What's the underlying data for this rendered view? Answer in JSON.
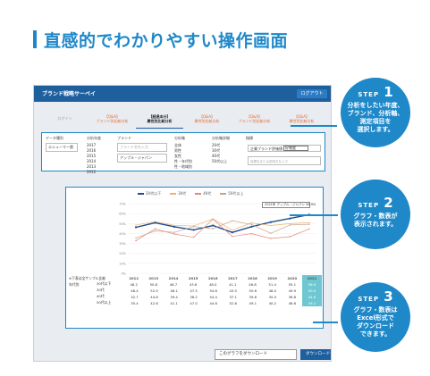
{
  "headline": "直感的でわかりやすい操作画面",
  "app": {
    "title": "ブランド戦略サーベイ",
    "logout": "ログアウト",
    "tabs": [
      {
        "top": "ログイン",
        "sub": "",
        "state": "muted"
      },
      {
        "top": "【Q&A】",
        "sub": "ブランド別比較分析",
        "state": ""
      },
      {
        "top": "【経過本分】",
        "sub": "属性別比較分析",
        "state": "active"
      },
      {
        "top": "【Q&A】",
        "sub": "属性別比較分析",
        "state": ""
      },
      {
        "top": "【Q&A】",
        "sub": "ブランド別比較分析",
        "state": ""
      },
      {
        "top": "【Q&A】",
        "sub": "属性別比較分析",
        "state": ""
      }
    ],
    "filter": {
      "data_label": "データ種別",
      "data_value": "エシューマー層",
      "year_label": "分析年度",
      "years": [
        "2017",
        "2016",
        "2015",
        "2014",
        "2013",
        "2012"
      ],
      "brand_label": "ブランド",
      "brand_placeholder": "ブランド名を入力",
      "brand_selected": "アップル・ジャパン",
      "axis_label": "分析軸",
      "axes": [
        "全体",
        "男性",
        "女性",
        "性・年代別",
        "性・地域別"
      ],
      "item_label": "分析軸詳細",
      "items": [
        "20代",
        "30代",
        "40代",
        "50代以上"
      ],
      "sort_label": "指標",
      "sort_box": "企業ブランド評価値",
      "sort_value": "好感度",
      "search_placeholder": "指標名または説明文を入力"
    },
    "chart": {
      "legend": [
        "20代以下",
        "30代",
        "40代",
        "50代以上"
      ],
      "yticks": [
        "70%",
        "60%",
        "50%",
        "40%",
        "30%",
        "20%",
        "10%",
        "0%"
      ],
      "tooltip": "2021年 アップル・ジャパン 58.9%"
    },
    "table": {
      "header_label": "※下表は全サンプル比較",
      "years": [
        "2012",
        "2013",
        "2014",
        "2015",
        "2016",
        "2017",
        "2018",
        "2019",
        "2020",
        "2021"
      ],
      "group_label": "年代別",
      "rows": [
        {
          "label": "30代以下",
          "values": [
            "46.2",
            "50.8",
            "46.7",
            "43.6",
            "48.0",
            "41.1",
            "46.8",
            "51.4",
            "55.1",
            "58.9"
          ]
        },
        {
          "label": "30代",
          "values": [
            "48.4",
            "52.0",
            "48.1",
            "47.5",
            "54.6",
            "43.5",
            "50.6",
            "48.0",
            "49.9",
            "50.9"
          ]
        },
        {
          "label": "40代",
          "values": [
            "32.7",
            "44.8",
            "39.4",
            "36.2",
            "54.4",
            "37.1",
            "39.8",
            "35.0",
            "36.8",
            "44.6"
          ]
        },
        {
          "label": "50代以上",
          "values": [
            "35.4",
            "42.6",
            "41.1",
            "47.0",
            "44.8",
            "52.8",
            "49.1",
            "40.2",
            "48.6",
            "49.2"
          ]
        }
      ]
    },
    "download": {
      "select": "このグラフをダウンロード",
      "button": "ダウンロードする"
    }
  },
  "steps": [
    {
      "label": "STEP",
      "num": "1",
      "text": "分析をしたい年度、\nブランド、分析軸、\n測定項目を\n選択します。"
    },
    {
      "label": "STEP",
      "num": "2",
      "text": "グラフ・数表が\n表示されます。"
    },
    {
      "label": "STEP",
      "num": "3",
      "text": "グラフ・数表は\nExcel形式で\nダウンロード\nできます。"
    }
  ],
  "colors": {
    "accent": "#1e88c9",
    "header": "#1e5f9e",
    "series": [
      "#1e4f8f",
      "#f2b36a",
      "#e8877a",
      "#c9a48a"
    ]
  }
}
